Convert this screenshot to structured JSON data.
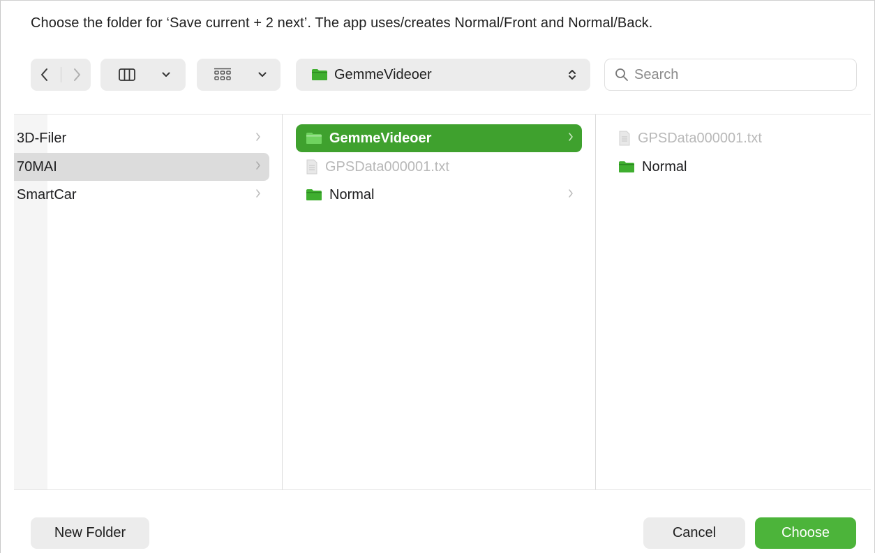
{
  "dialog": {
    "message": "Choose the folder for ‘Save current + 2 next’. The app uses/creates Normal/Front and Normal/Back."
  },
  "toolbar": {
    "path_popup": {
      "label": "GemmeVideoer"
    },
    "search": {
      "placeholder": "Search",
      "value": ""
    }
  },
  "columns": [
    {
      "items": [
        {
          "label": "3D-Filer"
        },
        {
          "label": "70MAI"
        },
        {
          "label": "SmartCar"
        }
      ]
    },
    {
      "items": [
        {
          "label": "GemmeVideoer"
        },
        {
          "label": "GPSData000001.txt"
        },
        {
          "label": "Normal"
        }
      ]
    },
    {
      "items": [
        {
          "label": "GPSData000001.txt"
        },
        {
          "label": "Normal"
        }
      ]
    }
  ],
  "footer": {
    "new_folder_label": "New Folder",
    "cancel_label": "Cancel",
    "choose_label": "Choose"
  },
  "colors": {
    "accent": "#3fa12e",
    "primary_button": "#4cb43a",
    "folder": "#3fae2f",
    "toolbar_bg": "#ececec",
    "selection_gray": "#dcdcdc"
  },
  "icons": [
    "chevron-left-icon",
    "chevron-right-icon",
    "column-view-icon",
    "chevron-down-icon",
    "grid-icon",
    "folder-icon",
    "up-down-chevron-icon",
    "search-icon",
    "document-icon"
  ]
}
